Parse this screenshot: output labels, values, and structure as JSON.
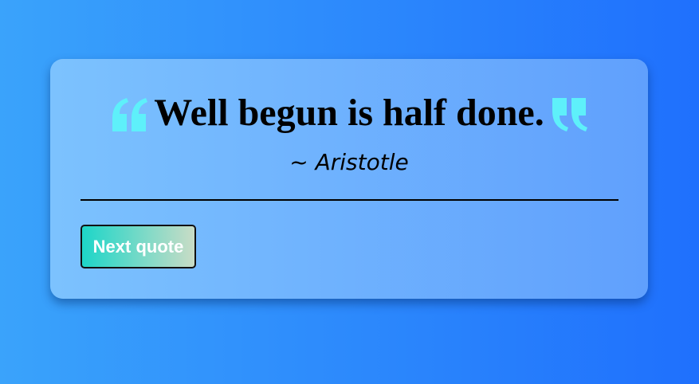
{
  "quote": {
    "text": "Well begun is half done.",
    "author": "~ Aristotle"
  },
  "actions": {
    "next_label": "Next quote"
  },
  "colors": {
    "background_start": "#3aa3fb",
    "background_end": "#1f70fd",
    "card_start": "#7cc2fe",
    "card_end": "#60a0fd",
    "quote_mark": "#5ef0fa",
    "button_start": "#1dd6c8",
    "button_end": "#c9dcc6"
  },
  "icons": {
    "open": "quote-left-icon",
    "close": "quote-right-icon"
  }
}
